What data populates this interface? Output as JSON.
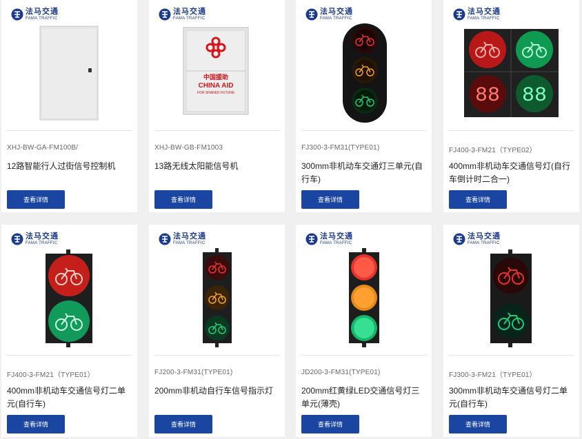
{
  "brand": {
    "name_cn": "法马交通",
    "name_en": "FAMA TRAFFIC"
  },
  "products": [
    {
      "model": "XHJ-BW-GA-FM100B/",
      "title": "12路智能行人过街信号控制机",
      "button": "查看详情",
      "image": "cabinet-image"
    },
    {
      "model": "XHJ-BW-GB-FM1003",
      "title": "13路无线太阳能信号机",
      "button": "查看详情",
      "image": "cabinet-image",
      "decal": {
        "line1": "中国援助",
        "line2": "CHINA AID",
        "line3": "FOR SHARED FUTURE"
      }
    },
    {
      "model": "FJ300-3-FM31(TYPE01)",
      "title": "300mm非机动车交通灯三单元(自行车)",
      "button": "查看详情",
      "image": "bicycle-signal-three-unit"
    },
    {
      "model": "FJ400-3-FM21（TYPE02）",
      "title": "400mm非机动车交通信号灯(自行车倒计时二合一)",
      "button": "查看详情",
      "image": "bicycle-countdown-signal",
      "countdown": "88"
    },
    {
      "model": "FJ400-3-FM21（TYPE01）",
      "title": "400mm非机动车交通信号灯二单元(自行车)",
      "button": "查看详情",
      "image": "bicycle-signal-two-unit"
    },
    {
      "model": "FJ200-3-FM31(TYPE01)",
      "title": "200mm非机动自行车信号指示灯",
      "button": "查看详情",
      "image": "bicycle-signal-three-unit"
    },
    {
      "model": "JD200-3-FM31(TYPE01)",
      "title": "200mm红黄绿LED交通信号灯三单元(薄壳)",
      "button": "查看详情",
      "image": "led-traffic-light"
    },
    {
      "model": "FJ300-3-FM21（TYPE01）",
      "title": "300mm非机动车交通信号灯二单元(自行车)",
      "button": "查看详情",
      "image": "bicycle-signal-two-unit"
    }
  ],
  "colors": {
    "accent": "#1a45a0",
    "lamp_red": "#e8322e",
    "lamp_amber": "#f0a020",
    "lamp_green": "#1ec97a",
    "housing": "#1c1c1c"
  }
}
